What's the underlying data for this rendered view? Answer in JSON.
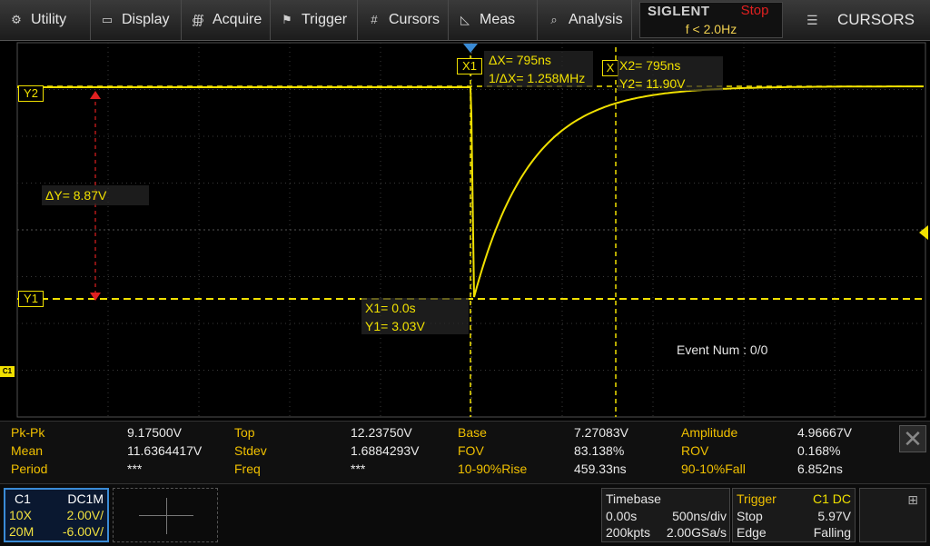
{
  "menu": {
    "items": [
      {
        "label": "Utility",
        "icon": "utility-icon"
      },
      {
        "label": "Display",
        "icon": "display-icon"
      },
      {
        "label": "Acquire",
        "icon": "acquire-icon"
      },
      {
        "label": "Trigger",
        "icon": "trigger-flag-icon"
      },
      {
        "label": "Cursors",
        "icon": "cursors-icon"
      },
      {
        "label": "Meas",
        "icon": "meas-icon"
      },
      {
        "label": "Analysis",
        "icon": "analysis-icon"
      }
    ]
  },
  "status": {
    "brand": "SIGLENT",
    "run_state": "Stop",
    "trigger_freq": "f < 2.0Hz"
  },
  "mode": {
    "label": "CURSORS"
  },
  "cursors": {
    "delta_x": "ΔX= 795ns",
    "inv_delta_x": "1/ΔX= 1.258MHz",
    "x2": "X2= 795ns",
    "y2": "Y2= 11.90V",
    "x1": "X1= 0.0s",
    "y1": "Y1= 3.03V",
    "delta_y": "ΔY= 8.87V",
    "tag_x1": "X1",
    "tag_x2": "X",
    "tag_y1": "Y1",
    "tag_y2": "Y2",
    "tag_c1": "C1"
  },
  "event_num": "Event Num : 0/0",
  "measurements": {
    "rows": [
      [
        {
          "label": "Pk-Pk",
          "value": "9.17500V"
        },
        {
          "label": "Top",
          "value": "12.23750V"
        },
        {
          "label": "Base",
          "value": "7.27083V"
        },
        {
          "label": "Amplitude",
          "value": "4.96667V"
        }
      ],
      [
        {
          "label": "Mean",
          "value": "11.6364417V"
        },
        {
          "label": "Stdev",
          "value": "1.6884293V"
        },
        {
          "label": "FOV",
          "value": "83.138%"
        },
        {
          "label": "ROV",
          "value": "0.168%"
        }
      ],
      [
        {
          "label": "Period",
          "value": "***"
        },
        {
          "label": "Freq",
          "value": "***"
        },
        {
          "label": "10-90%Rise",
          "value": "459.33ns"
        },
        {
          "label": "90-10%Fall",
          "value": "6.852ns"
        }
      ]
    ]
  },
  "channel": {
    "name": "C1",
    "coupling": "DC1M",
    "probe": "10X",
    "scale": "2.00V/",
    "bw": "20M",
    "offset": "-6.00V/"
  },
  "timebase": {
    "title": "Timebase",
    "delay": "0.00s",
    "scale": "500ns/div",
    "points": "200kpts",
    "rate": "2.00GSa/s"
  },
  "trigger": {
    "title": "Trigger",
    "source": "C1 DC",
    "state": "Stop",
    "level": "5.97V",
    "type": "Edge",
    "slope": "Falling"
  },
  "colors": {
    "trace": "#f0e000",
    "menu_accent": "#f0c000",
    "stop": "#e02020",
    "grid": "#3a3a3a",
    "channel_border": "#3a8bd6"
  }
}
